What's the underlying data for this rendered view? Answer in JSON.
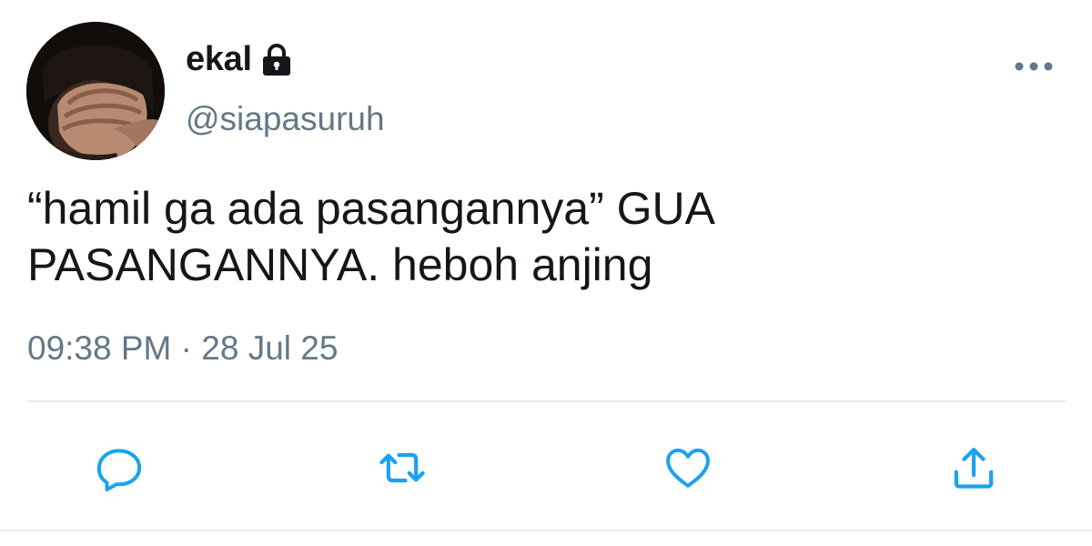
{
  "user": {
    "display_name": "ekal",
    "handle": "@siapasuruh",
    "protected_icon": "lock-icon",
    "avatar": "profile-photo-face-covered-with-hand"
  },
  "tweet": {
    "text": "“hamil ga ada pasangannya” GUA\nPASANGANNYA. heboh anjing",
    "time": "09:38 PM",
    "separator": "·",
    "date": "28 Jul 25"
  },
  "actions": {
    "more": "more-icon",
    "reply": "reply-icon",
    "retweet": "retweet-icon",
    "like": "like-icon",
    "share": "share-icon"
  },
  "colors": {
    "text": "#14171a",
    "secondary": "#657786",
    "icon": "#1da1f2",
    "divider": "#e6ecf0"
  }
}
